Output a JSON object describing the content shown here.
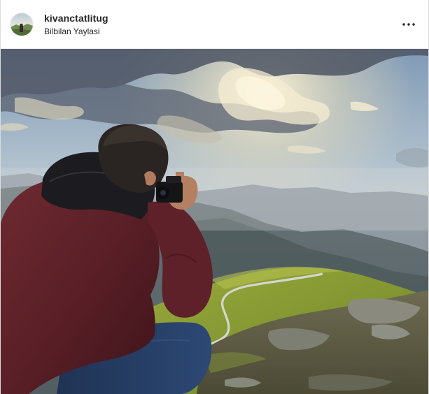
{
  "post": {
    "username": "kivanctatlitug",
    "location": "Bilbilan Yaylasi",
    "avatar_icon": "profile-photo",
    "more_icon": "more-options-icon",
    "photo_subject": "photographer-on-mountain-photo"
  },
  "colors": {
    "text": "#262626",
    "border": "#dbdbdb"
  }
}
